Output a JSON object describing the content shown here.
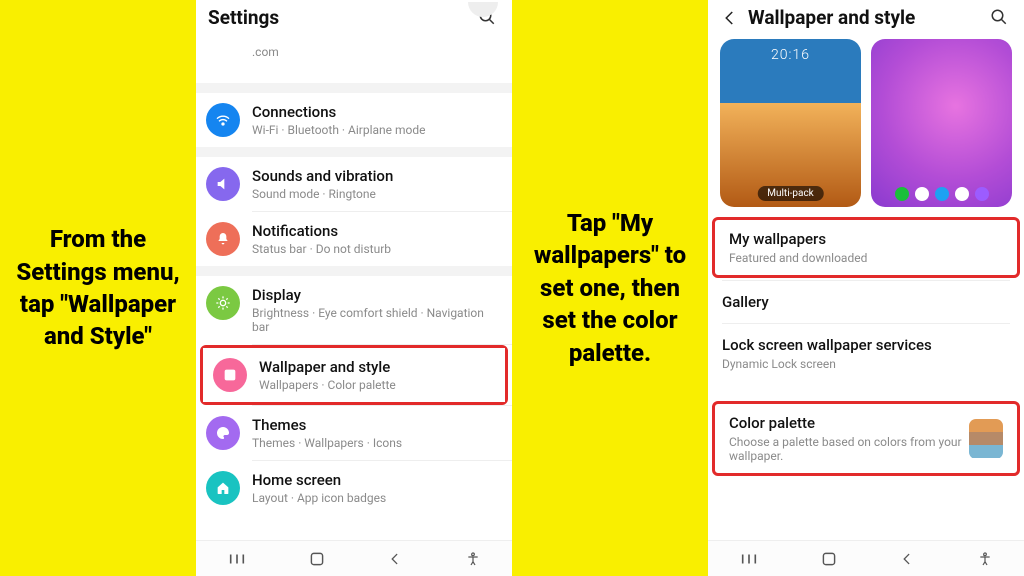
{
  "captions": {
    "left": "From the Settings menu, tap \"Wallpaper and Style\"",
    "right": "Tap \"My wallpapers\" to set one, then set the color palette."
  },
  "phone1": {
    "header": {
      "title": "Settings"
    },
    "truncated": {
      "text": ".com"
    },
    "items": [
      {
        "icon": "wifi",
        "iconClass": "ico-blue",
        "title": "Connections",
        "sub": "Wi-Fi · Bluetooth · Airplane mode"
      },
      {
        "icon": "sound",
        "iconClass": "ico-purple",
        "title": "Sounds and vibration",
        "sub": "Sound mode · Ringtone"
      },
      {
        "icon": "bell",
        "iconClass": "ico-coral",
        "title": "Notifications",
        "sub": "Status bar · Do not disturb"
      },
      {
        "icon": "display",
        "iconClass": "ico-green",
        "title": "Display",
        "sub": "Brightness · Eye comfort shield · Navigation bar"
      },
      {
        "icon": "wallpaper",
        "iconClass": "ico-pink",
        "title": "Wallpaper and style",
        "sub": "Wallpapers · Color palette",
        "highlight": true
      },
      {
        "icon": "palette",
        "iconClass": "ico-violet",
        "title": "Themes",
        "sub": "Themes · Wallpapers · Icons"
      },
      {
        "icon": "home",
        "iconClass": "ico-teal",
        "title": "Home screen",
        "sub": "Layout · App icon badges"
      }
    ]
  },
  "phone2": {
    "header": {
      "title": "Wallpaper and style"
    },
    "thumbs": {
      "clock": "20:16",
      "multi_label": "Multi-pack"
    },
    "items": [
      {
        "title": "My wallpapers",
        "sub": "Featured and downloaded",
        "highlight": true
      },
      {
        "title": "Gallery"
      },
      {
        "title": "Lock screen wallpaper services",
        "sub": "Dynamic Lock screen"
      },
      {
        "title": "Color palette",
        "sub": "Choose a palette based on colors from your wallpaper.",
        "highlight": true,
        "swatch": true
      }
    ]
  },
  "navbar": {
    "recent": "|||",
    "home": "○",
    "back": "<",
    "assist": "✶"
  }
}
